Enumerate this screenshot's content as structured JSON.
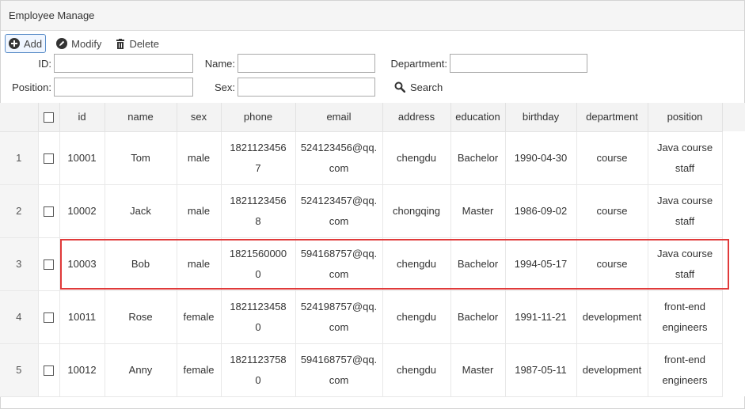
{
  "panel": {
    "title": "Employee Manage"
  },
  "toolbar": {
    "add_label": "Add",
    "modify_label": "Modify",
    "delete_label": "Delete"
  },
  "search_form": {
    "id_label": "ID:",
    "id_value": "",
    "name_label": "Name:",
    "name_value": "",
    "department_label": "Department:",
    "department_value": "",
    "position_label": "Position:",
    "position_value": "",
    "sex_label": "Sex:",
    "sex_value": "",
    "search_label": "Search"
  },
  "table": {
    "headers": {
      "id": "id",
      "name": "name",
      "sex": "sex",
      "phone": "phone",
      "email": "email",
      "address": "address",
      "education": "education",
      "birthday": "birthday",
      "department": "department",
      "position": "position"
    },
    "rows": [
      {
        "num": "1",
        "id": "10001",
        "name": "Tom",
        "sex": "male",
        "phone_1": "1821123456",
        "phone_2": "7",
        "email_1": "524123456@qq.",
        "email_2": "com",
        "address": "chengdu",
        "education": "Bachelor",
        "birthday": "1990-04-30",
        "department": "course",
        "position_1": "Java course",
        "position_2": "staff"
      },
      {
        "num": "2",
        "id": "10002",
        "name": "Jack",
        "sex": "male",
        "phone_1": "1821123456",
        "phone_2": "8",
        "email_1": "524123457@qq.",
        "email_2": "com",
        "address": "chongqing",
        "education": "Master",
        "birthday": "1986-09-02",
        "department": "course",
        "position_1": "Java course",
        "position_2": "staff"
      },
      {
        "num": "3",
        "id": "10003",
        "name": "Bob",
        "sex": "male",
        "phone_1": "1821560000",
        "phone_2": "0",
        "email_1": "594168757@qq.",
        "email_2": "com",
        "address": "chengdu",
        "education": "Bachelor",
        "birthday": "1994-05-17",
        "department": "course",
        "position_1": "Java course",
        "position_2": "staff"
      },
      {
        "num": "4",
        "id": "10011",
        "name": "Rose",
        "sex": "female",
        "phone_1": "1821123458",
        "phone_2": "0",
        "email_1": "524198757@qq.",
        "email_2": "com",
        "address": "chengdu",
        "education": "Bachelor",
        "birthday": "1991-11-21",
        "department": "development",
        "position_1": "front-end",
        "position_2": "engineers"
      },
      {
        "num": "5",
        "id": "10012",
        "name": "Anny",
        "sex": "female",
        "phone_1": "1821123758",
        "phone_2": "0",
        "email_1": "594168757@qq.",
        "email_2": "com",
        "address": "chengdu",
        "education": "Master",
        "birthday": "1987-05-11",
        "department": "development",
        "position_1": "front-end",
        "position_2": "engineers"
      }
    ]
  },
  "colors": {
    "highlight": "#e03a3a",
    "active_border": "#5b8ec9"
  },
  "icons": {
    "add": "plus-circle-icon",
    "modify": "pencil-circle-icon",
    "delete": "trash-icon",
    "search": "magnifier-icon"
  }
}
